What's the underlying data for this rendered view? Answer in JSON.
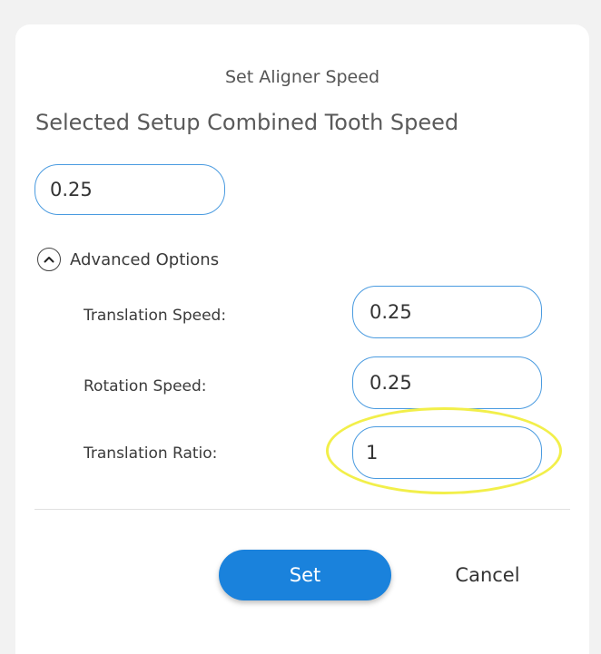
{
  "dialog": {
    "title": "Set Aligner Speed",
    "subtitle": "Selected Setup Combined Tooth Speed",
    "combined_speed_value": "0.25",
    "advanced_options": {
      "label": "Advanced Options",
      "toggle_icon": "chevron-up-circle-icon",
      "expanded": true,
      "fields": [
        {
          "label": "Translation Speed:",
          "value": "0.25"
        },
        {
          "label": "Rotation Speed:",
          "value": "0.25"
        },
        {
          "label": "Translation Ratio:",
          "value": "1"
        }
      ]
    },
    "buttons": {
      "set_label": "Set",
      "cancel_label": "Cancel"
    },
    "colors": {
      "accent": "#1a82dc",
      "input_border": "#4a9be0",
      "highlight": "#f2ef4a"
    }
  }
}
